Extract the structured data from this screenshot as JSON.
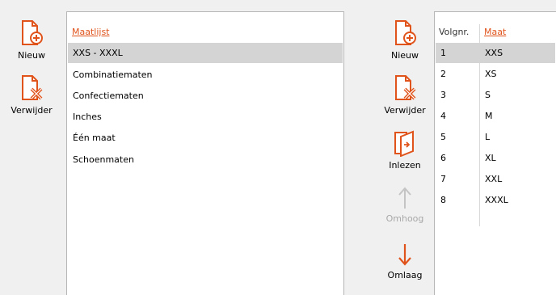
{
  "left_toolbar": {
    "new_label": "Nieuw",
    "delete_label": "Verwijder"
  },
  "size_lists": {
    "header": "Maatlijst",
    "items": [
      {
        "label": "XXS - XXXL",
        "selected": true
      },
      {
        "label": "Combinatiematen"
      },
      {
        "label": "Confectiematen"
      },
      {
        "label": "Inches"
      },
      {
        "label": "Één maat"
      },
      {
        "label": "Schoenmaten"
      }
    ]
  },
  "right_toolbar": {
    "new_label": "Nieuw",
    "delete_label": "Verwijder",
    "import_label": "Inlezen",
    "up_label": "Omhoog",
    "up_disabled": true,
    "down_label": "Omlaag"
  },
  "sizes_table": {
    "columns": [
      "Volgnr.",
      "Maat"
    ],
    "rows": [
      {
        "nr": "1",
        "size": "XXS",
        "selected": true
      },
      {
        "nr": "2",
        "size": "XS"
      },
      {
        "nr": "3",
        "size": "S"
      },
      {
        "nr": "4",
        "size": "M"
      },
      {
        "nr": "5",
        "size": "L"
      },
      {
        "nr": "6",
        "size": "XL"
      },
      {
        "nr": "7",
        "size": "XXL"
      },
      {
        "nr": "8",
        "size": "XXXL"
      }
    ]
  },
  "colors": {
    "accent": "#e0541c",
    "selection": "#d4d4d4",
    "disabled": "#a8a8a8"
  }
}
